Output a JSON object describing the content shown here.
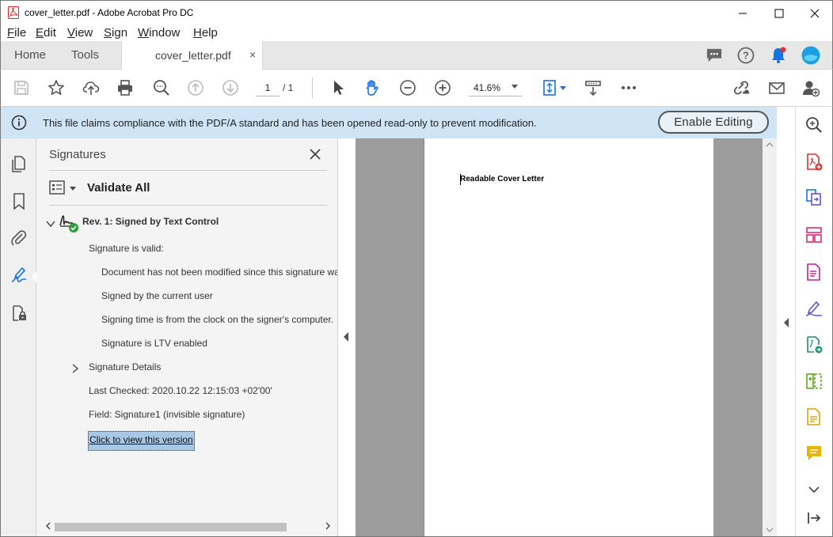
{
  "window": {
    "title": "cover_letter.pdf - Adobe Acrobat Pro DC"
  },
  "menu": {
    "items": [
      {
        "label": "File",
        "accel": "F",
        "rest": "ile"
      },
      {
        "label": "Edit",
        "accel": "E",
        "rest": "dit"
      },
      {
        "label": "View",
        "accel": "V",
        "rest": "iew"
      },
      {
        "label": "Sign",
        "accel": "S",
        "rest": "ign"
      },
      {
        "label": "Window",
        "accel": "W",
        "rest": "indow"
      },
      {
        "label": "Help",
        "accel": "H",
        "rest": "elp"
      }
    ]
  },
  "tabs": {
    "home": "Home",
    "tools": "Tools",
    "document": "cover_letter.pdf",
    "close": "×"
  },
  "toolbar": {
    "page_current": "1",
    "page_total": "/   1",
    "zoom": "41.6%"
  },
  "banner": {
    "message": "This file claims compliance with the PDF/A standard and has been opened read-only to prevent modification.",
    "button": "Enable Editing"
  },
  "signatures": {
    "title": "Signatures",
    "validate_all": "Validate All",
    "revision": "Rev. 1: Signed by Text Control",
    "valid_label": "Signature is valid:",
    "checks": [
      "Document has not been modified since this signature was applied",
      "Signed by the current user",
      "Signing time is from the clock on the signer's computer.",
      "Signature is LTV enabled"
    ],
    "details": "Signature Details",
    "last_checked": "Last Checked: 2020.10.22 12:15:03 +02'00'",
    "field": "Field: Signature1 (invisible signature)",
    "view_version": "Click to view this version"
  },
  "document": {
    "text": "Readable Cover Letter"
  },
  "colors": {
    "banner_bg": "#cfe4f4",
    "accent_blue": "#1473e6",
    "acrobat_red": "#e03030",
    "selection": "#a8c8e8"
  }
}
